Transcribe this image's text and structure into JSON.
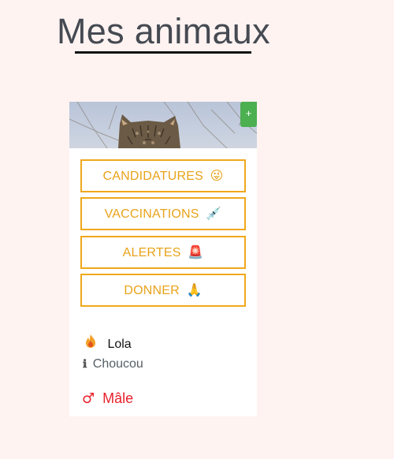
{
  "page": {
    "title": "Mes animaux"
  },
  "card": {
    "add_label": "+",
    "buttons": [
      {
        "label": "CANDIDATURES",
        "emoji": "😜"
      },
      {
        "label": "VACCINATIONS",
        "emoji": "💉"
      },
      {
        "label": "ALERTES",
        "emoji": "🚨"
      },
      {
        "label": "DONNER",
        "emoji": "🙏"
      }
    ],
    "pet": {
      "name_icon": "flame-icon",
      "name": "Lola",
      "nickname_icon": "info-icon",
      "nickname_icon_glyph": "ℹ",
      "nickname": "Choucou",
      "sex_icon": "male-symbol-icon",
      "sex_glyph": "♂",
      "sex": "Mâle"
    }
  },
  "colors": {
    "background": "#fff3f1",
    "accent_orange": "#f0a81c",
    "add_green": "#4caf50",
    "sex_red": "#e8202a"
  }
}
